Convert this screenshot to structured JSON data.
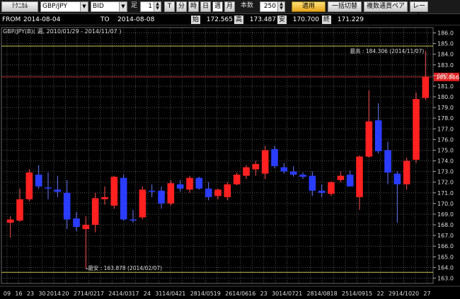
{
  "toolbar": {
    "technical_label": "ﾃｸﾆｶﾙ",
    "pair_value": "GBP/JPY",
    "side_value": "BID",
    "ashi_label": "足",
    "ashi_value": "1",
    "periods": [
      "T",
      "分",
      "時",
      "日",
      "週",
      "月"
    ],
    "selected_period": "週",
    "count_label": "本数",
    "count_value": "250",
    "apply_label": "適用",
    "batch_label": "一括切替",
    "multi_pair_label": "複数通貨ペア",
    "rate_label": "レート"
  },
  "info": {
    "from_label": "FROM",
    "from_date": "2014-08-04",
    "to_label": "TO",
    "to_date": "2014-08-08",
    "open_label": "始",
    "open_value": "172.565",
    "high_label": "高",
    "high_value": "173.487",
    "low_label": "安",
    "low_value": "170.700",
    "close_label": "終",
    "close_value": "171.229"
  },
  "chart_data": {
    "type": "candlestick",
    "title": "GBP/JPY(B)( 週, 2010/01/29 - 2014/11/07 )",
    "ylim": [
      162.5,
      186.5
    ],
    "y_ticks": [
      163.0,
      164.0,
      165.0,
      166.0,
      167.0,
      168.0,
      169.0,
      170.0,
      171.0,
      172.0,
      173.0,
      174.0,
      175.0,
      176.0,
      177.0,
      178.0,
      179.0,
      180.0,
      181.0,
      182.0,
      183.0,
      184.0,
      185.0,
      186.0
    ],
    "x_tick_labels": [
      "09",
      "16",
      "23",
      "30",
      "2014",
      "20",
      "27",
      "14/02",
      "17",
      "24",
      "14/03",
      "17",
      "24",
      "31",
      "14/04",
      "21",
      "28",
      "14/05",
      "19",
      "26",
      "14/06",
      "16",
      "23",
      "30",
      "14/07",
      "21",
      "28",
      "14/08",
      "18",
      "25",
      "14/09",
      "15",
      "22",
      "29",
      "14/10",
      "20",
      "27"
    ],
    "current_price": "181.866",
    "current_price_value": 181.866,
    "high_annotation": "最高 : 184.306 (2014/11/07)",
    "high_value": 184.306,
    "low_annotation": "最安 : 163.878 (2014/02/07)",
    "low_value": 163.878,
    "candles": [
      {
        "o": 168.2,
        "h": 168.8,
        "l": 166.8,
        "c": 168.5
      },
      {
        "o": 168.4,
        "h": 171.4,
        "l": 168.3,
        "c": 170.4
      },
      {
        "o": 170.4,
        "h": 173.2,
        "l": 170.2,
        "c": 172.9
      },
      {
        "o": 172.7,
        "h": 173.6,
        "l": 171.4,
        "c": 171.6
      },
      {
        "o": 171.5,
        "h": 172.9,
        "l": 170.4,
        "c": 171.4
      },
      {
        "o": 171.3,
        "h": 172.6,
        "l": 170.6,
        "c": 171.1
      },
      {
        "o": 171.0,
        "h": 172.2,
        "l": 167.6,
        "c": 168.5
      },
      {
        "o": 168.6,
        "h": 169.2,
        "l": 167.4,
        "c": 167.8
      },
      {
        "o": 167.6,
        "h": 168.8,
        "l": 163.9,
        "c": 168.0
      },
      {
        "o": 168.0,
        "h": 171.0,
        "l": 167.3,
        "c": 170.5
      },
      {
        "o": 170.4,
        "h": 171.6,
        "l": 169.9,
        "c": 170.6
      },
      {
        "o": 169.8,
        "h": 172.6,
        "l": 169.5,
        "c": 172.5
      },
      {
        "o": 172.4,
        "h": 172.7,
        "l": 168.4,
        "c": 168.5
      },
      {
        "o": 168.5,
        "h": 169.4,
        "l": 168.2,
        "c": 168.4
      },
      {
        "o": 168.7,
        "h": 171.6,
        "l": 168.5,
        "c": 171.3
      },
      {
        "o": 171.2,
        "h": 171.8,
        "l": 170.6,
        "c": 171.1
      },
      {
        "o": 171.2,
        "h": 171.6,
        "l": 169.5,
        "c": 170.0
      },
      {
        "o": 170.0,
        "h": 172.2,
        "l": 169.8,
        "c": 171.9
      },
      {
        "o": 171.8,
        "h": 172.2,
        "l": 171.1,
        "c": 171.4
      },
      {
        "o": 171.3,
        "h": 172.6,
        "l": 171.0,
        "c": 172.4
      },
      {
        "o": 172.4,
        "h": 172.5,
        "l": 171.3,
        "c": 171.4
      },
      {
        "o": 171.4,
        "h": 172.0,
        "l": 170.3,
        "c": 170.6
      },
      {
        "o": 170.7,
        "h": 171.4,
        "l": 170.4,
        "c": 171.3
      },
      {
        "o": 170.6,
        "h": 172.0,
        "l": 170.3,
        "c": 171.8
      },
      {
        "o": 171.8,
        "h": 172.9,
        "l": 171.7,
        "c": 172.7
      },
      {
        "o": 172.6,
        "h": 173.6,
        "l": 172.3,
        "c": 173.4
      },
      {
        "o": 173.2,
        "h": 174.0,
        "l": 172.6,
        "c": 173.7
      },
      {
        "o": 172.8,
        "h": 175.4,
        "l": 172.3,
        "c": 175.0
      },
      {
        "o": 175.1,
        "h": 175.4,
        "l": 173.3,
        "c": 173.5
      },
      {
        "o": 173.4,
        "h": 173.8,
        "l": 172.8,
        "c": 173.0
      },
      {
        "o": 173.0,
        "h": 173.5,
        "l": 172.5,
        "c": 172.7
      },
      {
        "o": 172.7,
        "h": 172.9,
        "l": 172.3,
        "c": 172.5
      },
      {
        "o": 172.6,
        "h": 173.0,
        "l": 170.7,
        "c": 171.2
      },
      {
        "o": 171.2,
        "h": 171.8,
        "l": 170.6,
        "c": 171.0
      },
      {
        "o": 170.9,
        "h": 172.1,
        "l": 170.7,
        "c": 172.0
      },
      {
        "o": 172.2,
        "h": 173.0,
        "l": 172.0,
        "c": 172.6
      },
      {
        "o": 172.7,
        "h": 173.1,
        "l": 171.6,
        "c": 171.6
      },
      {
        "o": 170.6,
        "h": 174.5,
        "l": 169.4,
        "c": 174.4
      },
      {
        "o": 174.4,
        "h": 180.6,
        "l": 174.3,
        "c": 177.7
      },
      {
        "o": 177.8,
        "h": 179.4,
        "l": 174.7,
        "c": 174.9
      },
      {
        "o": 175.0,
        "h": 175.8,
        "l": 171.8,
        "c": 172.9
      },
      {
        "o": 172.8,
        "h": 173.0,
        "l": 168.2,
        "c": 171.8
      },
      {
        "o": 171.8,
        "h": 174.3,
        "l": 171.3,
        "c": 174.0
      },
      {
        "o": 174.1,
        "h": 180.4,
        "l": 173.8,
        "c": 179.8
      },
      {
        "o": 179.9,
        "h": 184.3,
        "l": 179.7,
        "c": 181.9
      }
    ]
  }
}
